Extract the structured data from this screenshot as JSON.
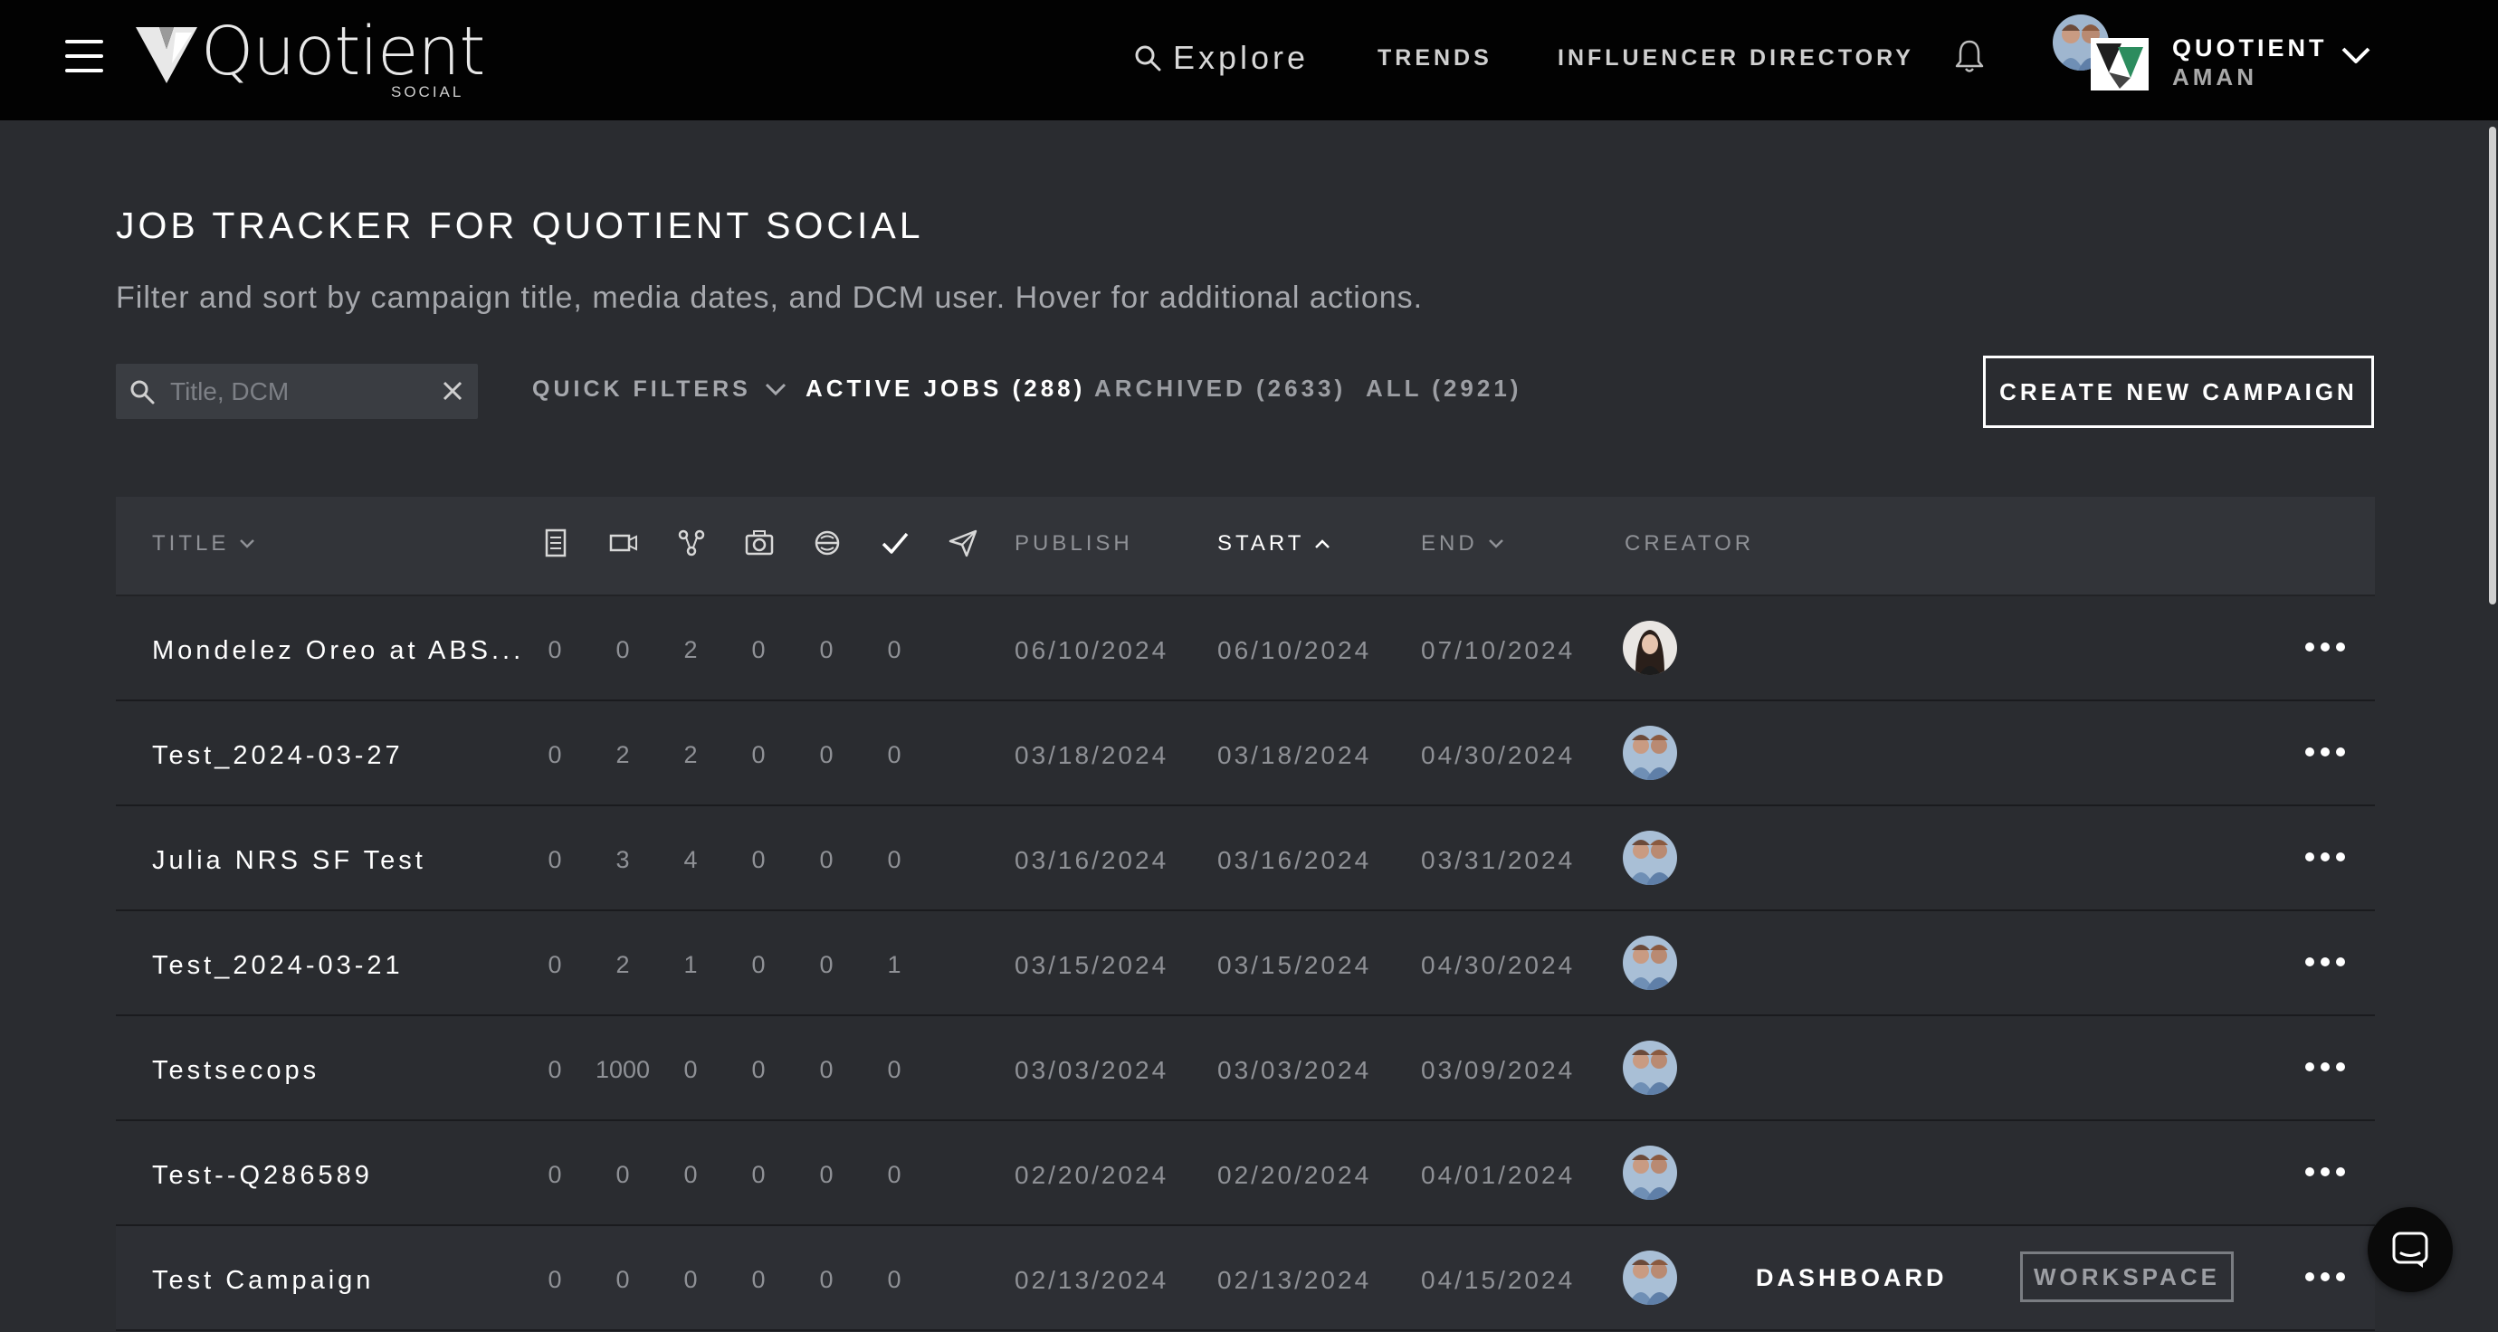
{
  "nav": {
    "logo_text": "Quotient",
    "logo_sub": "SOCIAL",
    "explore": "Explore",
    "trends": "TRENDS",
    "influencer_directory": "INFLUENCER DIRECTORY",
    "user_org": "QUOTIENT",
    "user_name": "AMAN"
  },
  "header": {
    "title": "JOB TRACKER FOR QUOTIENT SOCIAL",
    "subtitle": "Filter and sort by campaign title, media dates, and DCM user. Hover for additional actions."
  },
  "filters": {
    "search_placeholder": "Title, DCM",
    "quick_filters": "QUICK FILTERS",
    "active": "ACTIVE JOBS (288)",
    "archived": "ARCHIVED (2633)",
    "all": "ALL (2921)",
    "create_button": "CREATE NEW CAMPAIGN"
  },
  "columns": {
    "title": "TITLE",
    "icons": [
      "document-icon",
      "video-icon",
      "network-icon",
      "camera-icon",
      "stamp-icon",
      "check-icon",
      "send-icon"
    ],
    "publish": "PUBLISH",
    "start": "START",
    "end": "END",
    "creator": "CREATOR"
  },
  "rows": [
    {
      "title": "Mondelez Oreo at ABS...",
      "counts": [
        "0",
        "0",
        "2",
        "0",
        "0",
        "0"
      ],
      "publish": "06/10/2024",
      "start": "06/10/2024",
      "end": "07/10/2024"
    },
    {
      "title": "Test_2024-03-27",
      "counts": [
        "0",
        "2",
        "2",
        "0",
        "0",
        "0"
      ],
      "publish": "03/18/2024",
      "start": "03/18/2024",
      "end": "04/30/2024"
    },
    {
      "title": "Julia NRS SF Test",
      "counts": [
        "0",
        "3",
        "4",
        "0",
        "0",
        "0"
      ],
      "publish": "03/16/2024",
      "start": "03/16/2024",
      "end": "03/31/2024"
    },
    {
      "title": "Test_2024-03-21",
      "counts": [
        "0",
        "2",
        "1",
        "0",
        "0",
        "1"
      ],
      "publish": "03/15/2024",
      "start": "03/15/2024",
      "end": "04/30/2024"
    },
    {
      "title": "Testsecops",
      "counts": [
        "0",
        "1000",
        "0",
        "0",
        "0",
        "0"
      ],
      "publish": "03/03/2024",
      "start": "03/03/2024",
      "end": "03/09/2024"
    },
    {
      "title": "Test--Q286589",
      "counts": [
        "0",
        "0",
        "0",
        "0",
        "0",
        "0"
      ],
      "publish": "02/20/2024",
      "start": "02/20/2024",
      "end": "04/01/2024"
    },
    {
      "title": "Test Campaign",
      "counts": [
        "0",
        "0",
        "0",
        "0",
        "0",
        "0"
      ],
      "publish": "02/13/2024",
      "start": "02/13/2024",
      "end": "04/15/2024"
    }
  ],
  "hover_row": {
    "dashboard": "DASHBOARD",
    "workspace": "WORKSPACE"
  },
  "colors": {
    "background": "#2a2c30",
    "topbar": "#020202",
    "header_row": "#323439",
    "muted_text": "#8f9196"
  }
}
